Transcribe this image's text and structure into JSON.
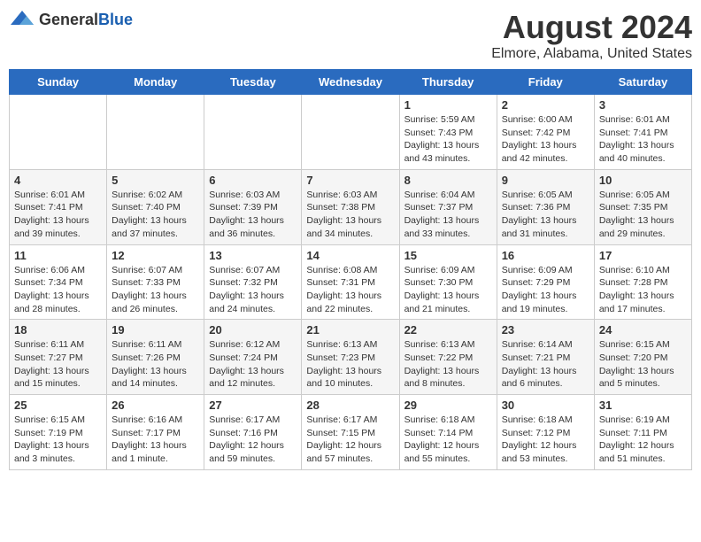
{
  "header": {
    "logo_general": "General",
    "logo_blue": "Blue",
    "month_title": "August 2024",
    "location": "Elmore, Alabama, United States"
  },
  "days_of_week": [
    "Sunday",
    "Monday",
    "Tuesday",
    "Wednesday",
    "Thursday",
    "Friday",
    "Saturday"
  ],
  "weeks": [
    [
      {
        "day": "",
        "info": ""
      },
      {
        "day": "",
        "info": ""
      },
      {
        "day": "",
        "info": ""
      },
      {
        "day": "",
        "info": ""
      },
      {
        "day": "1",
        "info": "Sunrise: 5:59 AM\nSunset: 7:43 PM\nDaylight: 13 hours\nand 43 minutes."
      },
      {
        "day": "2",
        "info": "Sunrise: 6:00 AM\nSunset: 7:42 PM\nDaylight: 13 hours\nand 42 minutes."
      },
      {
        "day": "3",
        "info": "Sunrise: 6:01 AM\nSunset: 7:41 PM\nDaylight: 13 hours\nand 40 minutes."
      }
    ],
    [
      {
        "day": "4",
        "info": "Sunrise: 6:01 AM\nSunset: 7:41 PM\nDaylight: 13 hours\nand 39 minutes."
      },
      {
        "day": "5",
        "info": "Sunrise: 6:02 AM\nSunset: 7:40 PM\nDaylight: 13 hours\nand 37 minutes."
      },
      {
        "day": "6",
        "info": "Sunrise: 6:03 AM\nSunset: 7:39 PM\nDaylight: 13 hours\nand 36 minutes."
      },
      {
        "day": "7",
        "info": "Sunrise: 6:03 AM\nSunset: 7:38 PM\nDaylight: 13 hours\nand 34 minutes."
      },
      {
        "day": "8",
        "info": "Sunrise: 6:04 AM\nSunset: 7:37 PM\nDaylight: 13 hours\nand 33 minutes."
      },
      {
        "day": "9",
        "info": "Sunrise: 6:05 AM\nSunset: 7:36 PM\nDaylight: 13 hours\nand 31 minutes."
      },
      {
        "day": "10",
        "info": "Sunrise: 6:05 AM\nSunset: 7:35 PM\nDaylight: 13 hours\nand 29 minutes."
      }
    ],
    [
      {
        "day": "11",
        "info": "Sunrise: 6:06 AM\nSunset: 7:34 PM\nDaylight: 13 hours\nand 28 minutes."
      },
      {
        "day": "12",
        "info": "Sunrise: 6:07 AM\nSunset: 7:33 PM\nDaylight: 13 hours\nand 26 minutes."
      },
      {
        "day": "13",
        "info": "Sunrise: 6:07 AM\nSunset: 7:32 PM\nDaylight: 13 hours\nand 24 minutes."
      },
      {
        "day": "14",
        "info": "Sunrise: 6:08 AM\nSunset: 7:31 PM\nDaylight: 13 hours\nand 22 minutes."
      },
      {
        "day": "15",
        "info": "Sunrise: 6:09 AM\nSunset: 7:30 PM\nDaylight: 13 hours\nand 21 minutes."
      },
      {
        "day": "16",
        "info": "Sunrise: 6:09 AM\nSunset: 7:29 PM\nDaylight: 13 hours\nand 19 minutes."
      },
      {
        "day": "17",
        "info": "Sunrise: 6:10 AM\nSunset: 7:28 PM\nDaylight: 13 hours\nand 17 minutes."
      }
    ],
    [
      {
        "day": "18",
        "info": "Sunrise: 6:11 AM\nSunset: 7:27 PM\nDaylight: 13 hours\nand 15 minutes."
      },
      {
        "day": "19",
        "info": "Sunrise: 6:11 AM\nSunset: 7:26 PM\nDaylight: 13 hours\nand 14 minutes."
      },
      {
        "day": "20",
        "info": "Sunrise: 6:12 AM\nSunset: 7:24 PM\nDaylight: 13 hours\nand 12 minutes."
      },
      {
        "day": "21",
        "info": "Sunrise: 6:13 AM\nSunset: 7:23 PM\nDaylight: 13 hours\nand 10 minutes."
      },
      {
        "day": "22",
        "info": "Sunrise: 6:13 AM\nSunset: 7:22 PM\nDaylight: 13 hours\nand 8 minutes."
      },
      {
        "day": "23",
        "info": "Sunrise: 6:14 AM\nSunset: 7:21 PM\nDaylight: 13 hours\nand 6 minutes."
      },
      {
        "day": "24",
        "info": "Sunrise: 6:15 AM\nSunset: 7:20 PM\nDaylight: 13 hours\nand 5 minutes."
      }
    ],
    [
      {
        "day": "25",
        "info": "Sunrise: 6:15 AM\nSunset: 7:19 PM\nDaylight: 13 hours\nand 3 minutes."
      },
      {
        "day": "26",
        "info": "Sunrise: 6:16 AM\nSunset: 7:17 PM\nDaylight: 13 hours\nand 1 minute."
      },
      {
        "day": "27",
        "info": "Sunrise: 6:17 AM\nSunset: 7:16 PM\nDaylight: 12 hours\nand 59 minutes."
      },
      {
        "day": "28",
        "info": "Sunrise: 6:17 AM\nSunset: 7:15 PM\nDaylight: 12 hours\nand 57 minutes."
      },
      {
        "day": "29",
        "info": "Sunrise: 6:18 AM\nSunset: 7:14 PM\nDaylight: 12 hours\nand 55 minutes."
      },
      {
        "day": "30",
        "info": "Sunrise: 6:18 AM\nSunset: 7:12 PM\nDaylight: 12 hours\nand 53 minutes."
      },
      {
        "day": "31",
        "info": "Sunrise: 6:19 AM\nSunset: 7:11 PM\nDaylight: 12 hours\nand 51 minutes."
      }
    ]
  ]
}
